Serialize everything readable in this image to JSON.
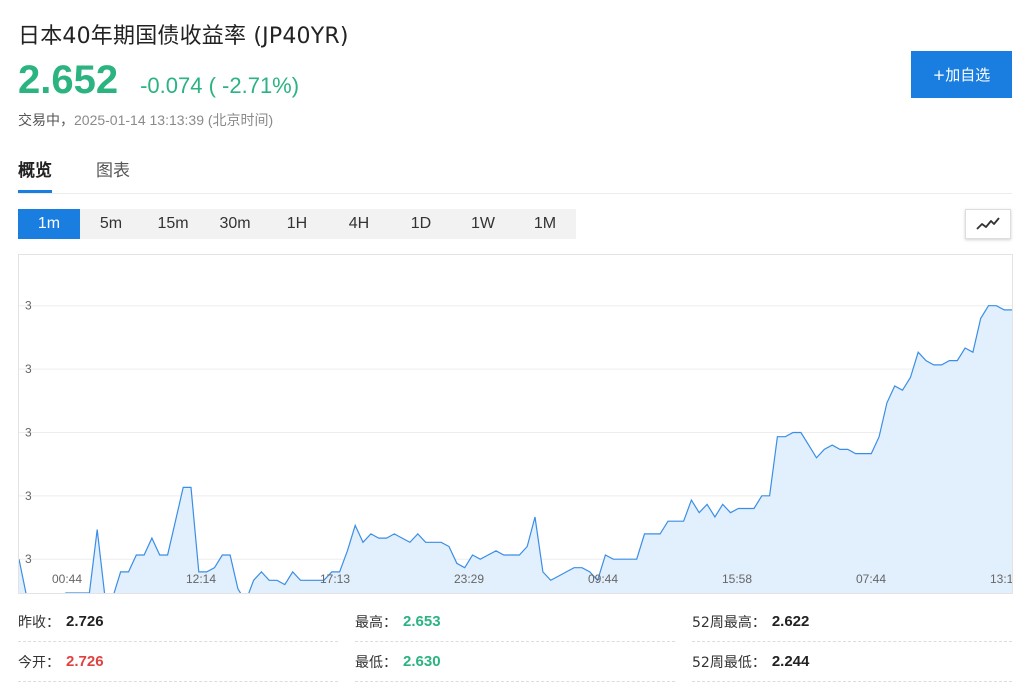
{
  "header": {
    "title": "日本40年期国债收益率 (JP40YR)",
    "price": "2.652",
    "change": "-0.074 ( -2.71%)",
    "status_label": "交易中，",
    "timestamp": "2025-01-14 13:13:39 (北京时间)",
    "add_watchlist": "+加自选"
  },
  "tabs": [
    {
      "label": "概览",
      "active": true
    },
    {
      "label": "图表",
      "active": false
    }
  ],
  "periods": [
    "1m",
    "5m",
    "15m",
    "30m",
    "1H",
    "4H",
    "1D",
    "1W",
    "1M"
  ],
  "active_period": "1m",
  "colors": {
    "accent": "#1a7de0",
    "up_green": "#2bb380",
    "down_red": "#e0433f",
    "line": "#3a8ee6",
    "fill": "#e2effc"
  },
  "chart_data": {
    "type": "area",
    "y_tick_labels": [
      "3",
      "3",
      "3",
      "3",
      "3"
    ],
    "x_tick_labels": [
      "00:44",
      "12:14",
      "17:13",
      "23:29",
      "09:44",
      "15:58",
      "07:44",
      "13:1"
    ],
    "ylim": [
      2.6,
      2.68
    ],
    "y_ticks": [
      2.608,
      2.623,
      2.638,
      2.653,
      2.668
    ],
    "values": [
      2.608,
      2.599,
      2.598,
      2.598,
      2.599,
      2.599,
      2.6,
      2.6,
      2.6,
      2.6,
      2.615,
      2.599,
      2.599,
      2.605,
      2.605,
      2.609,
      2.609,
      2.613,
      2.609,
      2.609,
      2.617,
      2.625,
      2.625,
      2.605,
      2.605,
      2.606,
      2.609,
      2.609,
      2.601,
      2.598,
      2.603,
      2.605,
      2.603,
      2.603,
      2.602,
      2.605,
      2.603,
      2.603,
      2.603,
      2.603,
      2.605,
      2.605,
      2.61,
      2.616,
      2.612,
      2.614,
      2.613,
      2.613,
      2.614,
      2.613,
      2.612,
      2.614,
      2.612,
      2.612,
      2.612,
      2.611,
      2.607,
      2.606,
      2.609,
      2.608,
      2.609,
      2.61,
      2.609,
      2.609,
      2.609,
      2.611,
      2.618,
      2.605,
      2.603,
      2.604,
      2.605,
      2.606,
      2.606,
      2.605,
      2.603,
      2.609,
      2.608,
      2.608,
      2.608,
      2.608,
      2.614,
      2.614,
      2.614,
      2.617,
      2.617,
      2.617,
      2.622,
      2.619,
      2.621,
      2.618,
      2.621,
      2.619,
      2.62,
      2.62,
      2.62,
      2.623,
      2.623,
      2.637,
      2.637,
      2.638,
      2.638,
      2.635,
      2.632,
      2.634,
      2.635,
      2.634,
      2.634,
      2.633,
      2.633,
      2.633,
      2.637,
      2.645,
      2.649,
      2.648,
      2.651,
      2.657,
      2.655,
      2.654,
      2.654,
      2.655,
      2.655,
      2.658,
      2.657,
      2.665,
      2.668,
      2.668,
      2.667,
      2.667
    ]
  },
  "stats": [
    {
      "label": "昨收：",
      "value": "2.726",
      "tone": "dark"
    },
    {
      "label": "最高：",
      "value": "2.653",
      "tone": "green"
    },
    {
      "label": "52周最高：",
      "value": "2.622",
      "tone": "dark"
    },
    {
      "label": "今开：",
      "value": "2.726",
      "tone": "red"
    },
    {
      "label": "最低：",
      "value": "2.630",
      "tone": "green"
    },
    {
      "label": "52周最低：",
      "value": "2.244",
      "tone": "dark"
    }
  ]
}
